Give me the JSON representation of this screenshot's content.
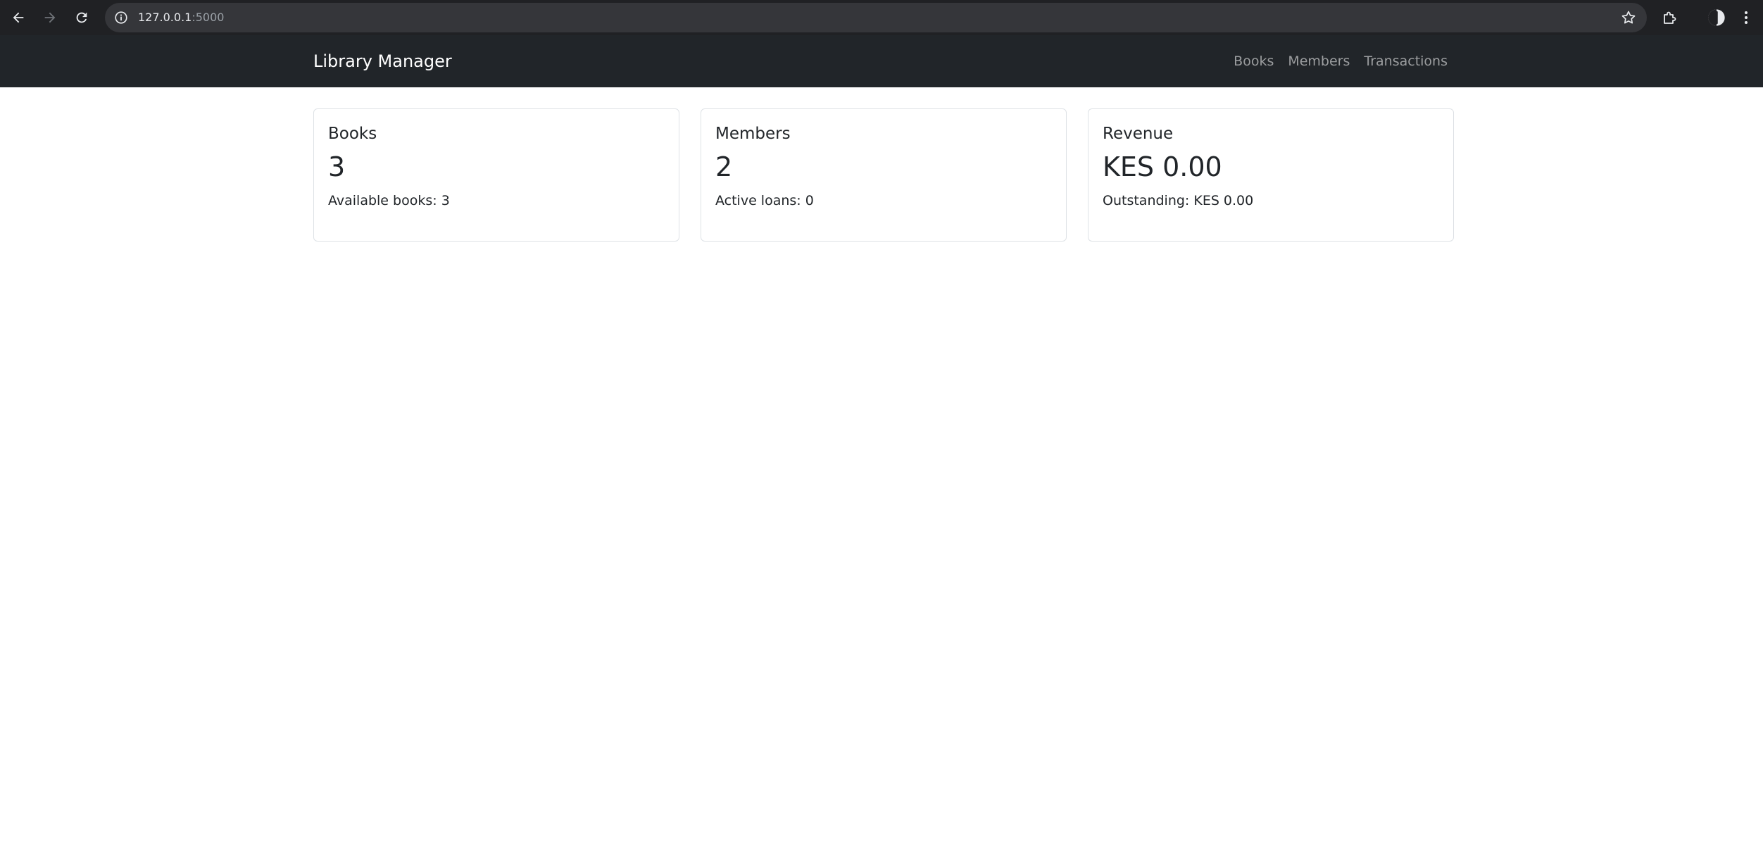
{
  "browser": {
    "url_host": "127.0.0.1",
    "url_port": ":5000"
  },
  "navbar": {
    "brand": "Library Manager",
    "links": [
      {
        "label": "Books"
      },
      {
        "label": "Members"
      },
      {
        "label": "Transactions"
      }
    ]
  },
  "cards": [
    {
      "title": "Books",
      "value": "3",
      "subtitle": "Available books: 3"
    },
    {
      "title": "Members",
      "value": "2",
      "subtitle": "Active loans: 0"
    },
    {
      "title": "Revenue",
      "value": "KES 0.00",
      "subtitle": "Outstanding: KES 0.00"
    }
  ],
  "colors": {
    "navbar_bg": "#212529",
    "card_border": "#dee2e6",
    "text": "#212529"
  },
  "icons": {
    "back": "arrow-left-icon",
    "forward": "arrow-right-icon",
    "reload": "reload-icon",
    "site_info": "info-icon",
    "bookmark": "star-icon",
    "extensions": "puzzle-icon",
    "profile": "profile-icon",
    "menu": "kebab-menu-icon"
  }
}
